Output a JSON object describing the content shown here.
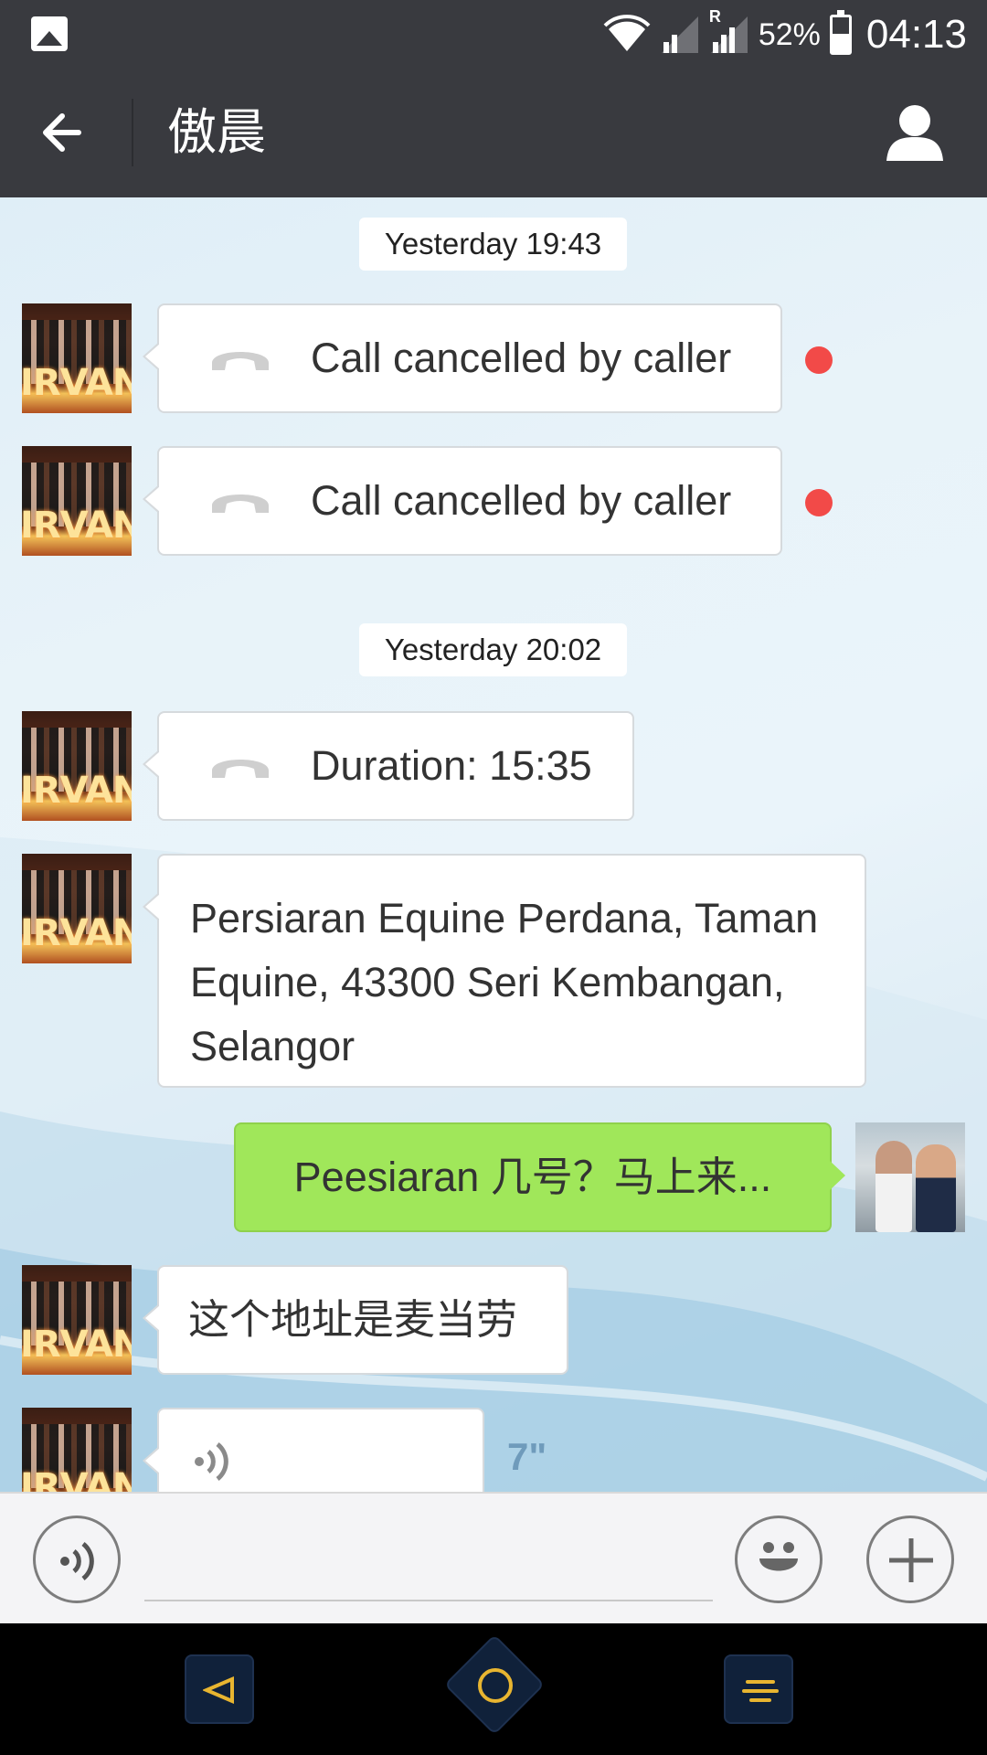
{
  "status_bar": {
    "battery_percent": "52%",
    "battery_level": 0.52,
    "time": "04:13",
    "icons": [
      "gallery-icon",
      "wifi-icon",
      "signal-icon",
      "roaming-signal-icon",
      "battery-icon"
    ],
    "roaming_label": "R"
  },
  "header": {
    "title": "傲晨",
    "back_icon": "arrow-left-icon",
    "profile_icon": "person-icon"
  },
  "chat": {
    "messages": [
      {
        "type": "timestamp",
        "text": "Yesterday 19:43"
      },
      {
        "type": "call",
        "direction": "incoming",
        "text": "Call cancelled by caller",
        "unread": true
      },
      {
        "type": "call",
        "direction": "incoming",
        "text": "Call cancelled by caller",
        "unread": true
      },
      {
        "type": "timestamp",
        "text": "Yesterday 20:02"
      },
      {
        "type": "call",
        "direction": "incoming",
        "text": "Duration: 15:35"
      },
      {
        "type": "text",
        "direction": "incoming",
        "text": "Persiaran Equine Perdana, Taman Equine, 43300 Seri Kembangan, Selangor"
      },
      {
        "type": "text",
        "direction": "outgoing",
        "text": "Peesiaran 几号？马上来..."
      },
      {
        "type": "text",
        "direction": "incoming",
        "text": "这个地址是麦当劳"
      },
      {
        "type": "voice",
        "direction": "incoming",
        "duration": "7\""
      }
    ],
    "incoming_avatar_text": "IRVANA"
  },
  "input_bar": {
    "voice_icon": "voice-icon",
    "emoji_icon": "smiley-icon",
    "plus_icon": "plus-icon"
  },
  "nav_bar": {
    "icons": [
      "back-triangle-icon",
      "home-circle-icon",
      "menu-icon"
    ]
  },
  "colors": {
    "header_bg": "#393a3f",
    "outgoing_bubble": "#a0e75a",
    "unread_dot": "#f24a48",
    "voice_duration": "#6f9bbb"
  }
}
